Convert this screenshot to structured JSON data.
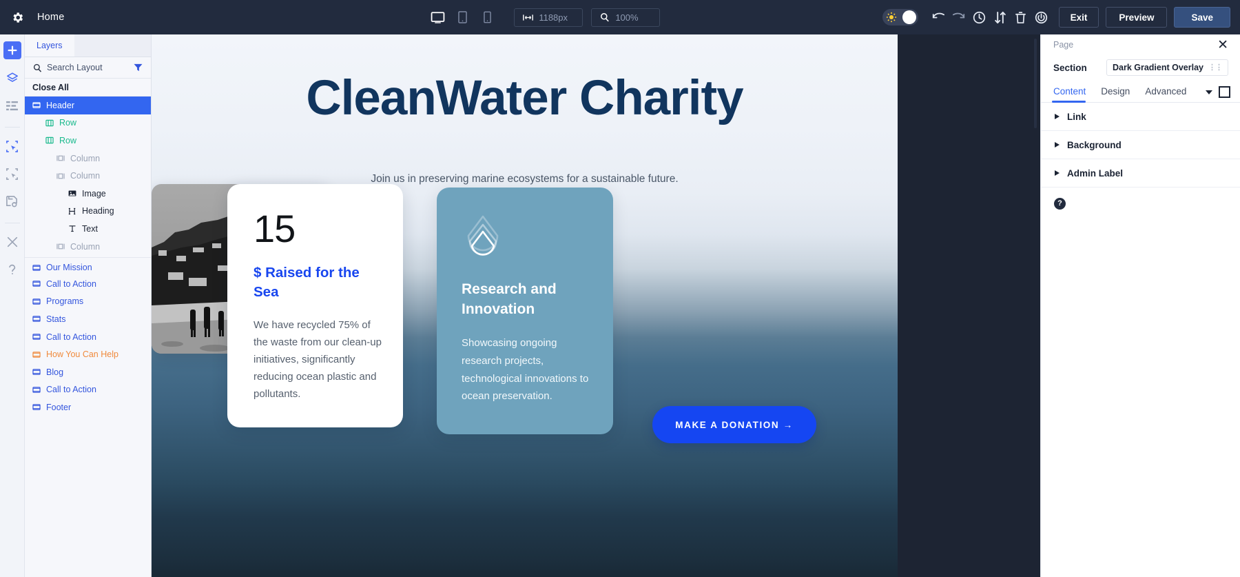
{
  "topbar": {
    "gear_icon": "gear-icon",
    "page_name": "Home",
    "devices": [
      {
        "name": "desktop-view",
        "icon": "desktop-icon"
      },
      {
        "name": "tablet-view",
        "icon": "tablet-icon"
      },
      {
        "name": "phone-view",
        "icon": "phone-icon"
      }
    ],
    "width_field": {
      "icon": "width-arrows-icon",
      "value": "1188px"
    },
    "zoom_field": {
      "icon": "magnifier-icon",
      "value": "100%"
    },
    "theme_toggle": {
      "icon": "sun-icon",
      "state": "light"
    },
    "actions": [
      {
        "name": "undo-button",
        "icon": "undo-icon"
      },
      {
        "name": "redo-button",
        "icon": "redo-icon"
      },
      {
        "name": "history-button",
        "icon": "clock-icon"
      },
      {
        "name": "portability-button",
        "icon": "updown-arrows-icon"
      },
      {
        "name": "trash-button",
        "icon": "trash-icon"
      },
      {
        "name": "power-button",
        "icon": "power-icon"
      }
    ],
    "exit_label": "Exit",
    "preview_label": "Preview",
    "save_label": "Save"
  },
  "rail": {
    "items": [
      {
        "name": "add-button",
        "icon": "plus-icon",
        "state": "active"
      },
      {
        "name": "layers-button",
        "icon": "layers-icon",
        "state": "normal"
      },
      {
        "name": "list-button",
        "icon": "list-icon",
        "state": "muted"
      },
      {
        "name": "select-button",
        "icon": "select-frame-icon",
        "state": "normal"
      },
      {
        "name": "clone-button",
        "icon": "clone-frame-icon",
        "state": "muted"
      },
      {
        "name": "save-library-button",
        "icon": "save-disk-icon",
        "state": "muted"
      },
      {
        "name": "tools-button",
        "icon": "wrench-cross-icon",
        "state": "muted"
      },
      {
        "name": "help-button",
        "icon": "question-icon",
        "state": "muted"
      }
    ]
  },
  "layers": {
    "tab_label": "Layers",
    "search_placeholder": "Search Layout",
    "search_icon": "search-icon",
    "filter_icon": "filter-icon",
    "close_all_label": "Close All",
    "items": [
      {
        "label": "Header",
        "icon": "section-icon",
        "depth": 0,
        "style": "sel"
      },
      {
        "label": "Row",
        "icon": "row-icon",
        "depth": 1,
        "style": "green"
      },
      {
        "label": "Row",
        "icon": "row-icon",
        "depth": 1,
        "style": "green"
      },
      {
        "label": "Column",
        "icon": "column-icon",
        "depth": 2,
        "style": "grey"
      },
      {
        "label": "Column",
        "icon": "column-icon",
        "depth": 2,
        "style": "grey"
      },
      {
        "label": "Image",
        "icon": "image-icon",
        "depth": 3,
        "style": "dark"
      },
      {
        "label": "Heading",
        "icon": "heading-icon",
        "depth": 3,
        "style": "dark"
      },
      {
        "label": "Text",
        "icon": "text-icon",
        "depth": 3,
        "style": "dark"
      },
      {
        "label": "Column",
        "icon": "column-icon",
        "depth": 2,
        "style": "grey"
      },
      {
        "label": "Our Mission",
        "icon": "section-icon",
        "depth": 0,
        "style": "blue",
        "divider": true
      },
      {
        "label": "Call to Action",
        "icon": "section-icon",
        "depth": 0,
        "style": "blue"
      },
      {
        "label": "Programs",
        "icon": "section-icon",
        "depth": 0,
        "style": "blue"
      },
      {
        "label": "Stats",
        "icon": "section-icon",
        "depth": 0,
        "style": "blue"
      },
      {
        "label": "Call to Action",
        "icon": "section-icon",
        "depth": 0,
        "style": "blue"
      },
      {
        "label": "How You Can Help",
        "icon": "section-icon",
        "depth": 0,
        "style": "orange"
      },
      {
        "label": "Blog",
        "icon": "section-icon",
        "depth": 0,
        "style": "blue"
      },
      {
        "label": "Call to Action",
        "icon": "section-icon",
        "depth": 0,
        "style": "blue"
      },
      {
        "label": "Footer",
        "icon": "section-icon",
        "depth": 0,
        "style": "blue"
      }
    ]
  },
  "canvas": {
    "hero_title": "CleanWater Charity",
    "hero_subtitle": "Join us in preserving marine ecosystems for a sustainable future.",
    "stat_card": {
      "number": "15",
      "heading": "$ Raised for the Sea",
      "body": "We have recycled 75% of the waste from our clean-up initiatives, significantly reducing ocean plastic and pollutants."
    },
    "blue_card": {
      "icon": "water-drop-icon",
      "heading": "Research and Innovation",
      "body": "Showcasing ongoing research projects, technological innovations to ocean preservation."
    },
    "photo": {
      "name": "beach-coastline-photo",
      "alt": "Black and white photo of people standing on a beach below a hillside town"
    },
    "donate_button": "MAKE A DONATION  →"
  },
  "rightpanel": {
    "title": "Page",
    "close_icon": "close-icon",
    "section_label": "Section",
    "section_value": "Dark Gradient Overlay",
    "tabs": [
      {
        "label": "Content",
        "active": true
      },
      {
        "label": "Design",
        "active": false
      },
      {
        "label": "Advanced",
        "active": false
      }
    ],
    "accordions": [
      {
        "label": "Link"
      },
      {
        "label": "Background"
      },
      {
        "label": "Admin Label"
      }
    ],
    "help_glyph": "?"
  },
  "colors": {
    "topbar_bg": "#222b3e",
    "accent_blue": "#3366f0",
    "save_button": "#35507e",
    "layer_green": "#19b98c",
    "layer_orange": "#f08a3c",
    "hero_title": "#11355e",
    "cta_blue": "#1546f2",
    "card_blue": "#6fa3bd"
  }
}
